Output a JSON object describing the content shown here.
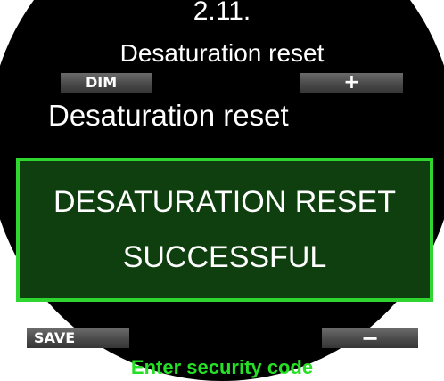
{
  "document": {
    "section_number": "2.11.",
    "section_title": "Desaturation reset"
  },
  "softkeys": {
    "top_left": "DIM",
    "top_right": "+",
    "bottom_left": "SAVE",
    "bottom_right": "−"
  },
  "screen": {
    "heading": "Desaturation reset",
    "status_line_1": "DESATURATION RESET",
    "status_line_2": "SUCCESSFUL",
    "hint": "Enter security code"
  },
  "colors": {
    "panel_border": "#2fd62f",
    "panel_fill": "#0f3f0f",
    "hint_text": "#25e025",
    "softkey_fill": "#4a4a4a",
    "screen_background": "#000000"
  }
}
